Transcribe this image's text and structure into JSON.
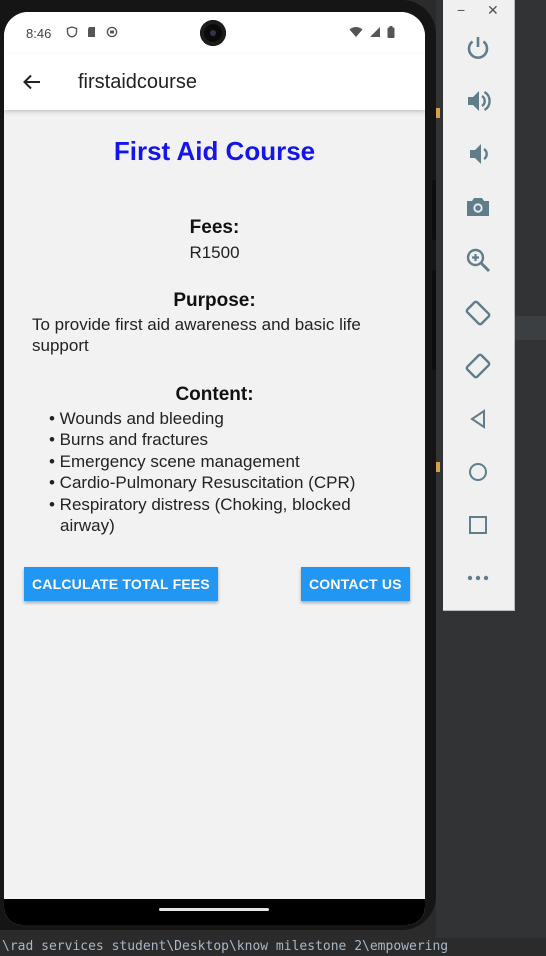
{
  "status_bar": {
    "time": "8:46"
  },
  "app_bar": {
    "title": "firstaidcourse"
  },
  "course": {
    "title": "First Aid Course",
    "fees_label": "Fees:",
    "fees_value": "R1500",
    "purpose_label": "Purpose:",
    "purpose_text": "To provide first aid awareness and basic life support",
    "content_label": "Content:",
    "content_items": [
      "• Wounds and bleeding",
      "• Burns and fractures",
      "• Emergency scene management",
      "• Cardio-Pulmonary Resuscitation (CPR)",
      "• Respiratory distress (Choking, blocked airway)"
    ]
  },
  "buttons": {
    "calculate": "CALCULATE TOTAL FEES",
    "contact": "CONTACT US"
  },
  "emulator": {
    "minimize": "−",
    "close": "✕"
  },
  "ide": {
    "console_line": "\\rad services student\\Desktop\\know milestone 2\\empowering"
  },
  "colors": {
    "title_blue": "#1515e8",
    "button_blue": "#2196f3"
  }
}
